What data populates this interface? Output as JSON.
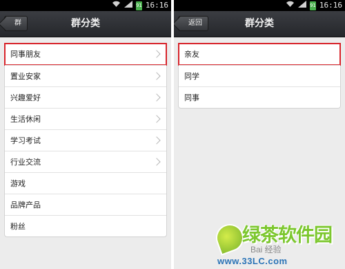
{
  "status_bar": {
    "time": "16:16",
    "battery": "91"
  },
  "left_screen": {
    "back_label": "群",
    "title": "群分类",
    "items": [
      {
        "label": "同事朋友",
        "chevron": true,
        "highlighted": true
      },
      {
        "label": "置业安家",
        "chevron": true
      },
      {
        "label": "兴趣爱好",
        "chevron": true
      },
      {
        "label": "生活休闲",
        "chevron": true
      },
      {
        "label": "学习考试",
        "chevron": true
      },
      {
        "label": "行业交流",
        "chevron": true
      },
      {
        "label": "游戏",
        "chevron": false
      },
      {
        "label": "品牌产品",
        "chevron": false
      },
      {
        "label": "粉丝",
        "chevron": false
      }
    ]
  },
  "right_screen": {
    "back_label": "返回",
    "title": "群分类",
    "items": [
      {
        "label": "亲友",
        "highlighted": true
      },
      {
        "label": "同学"
      },
      {
        "label": "同事"
      }
    ]
  },
  "watermark": {
    "brand": "绿茶软件园",
    "baidu": "Bai 经验",
    "url": "www.33LC.com"
  },
  "colors": {
    "highlight": "#d8232a",
    "titlebar": "#2e3034",
    "brand_green": "#7cc72e",
    "url_blue": "#2b74b7"
  },
  "icons": [
    "wifi-icon",
    "signal-icon",
    "battery-icon",
    "chevron-right-icon",
    "back-arrow-icon"
  ]
}
